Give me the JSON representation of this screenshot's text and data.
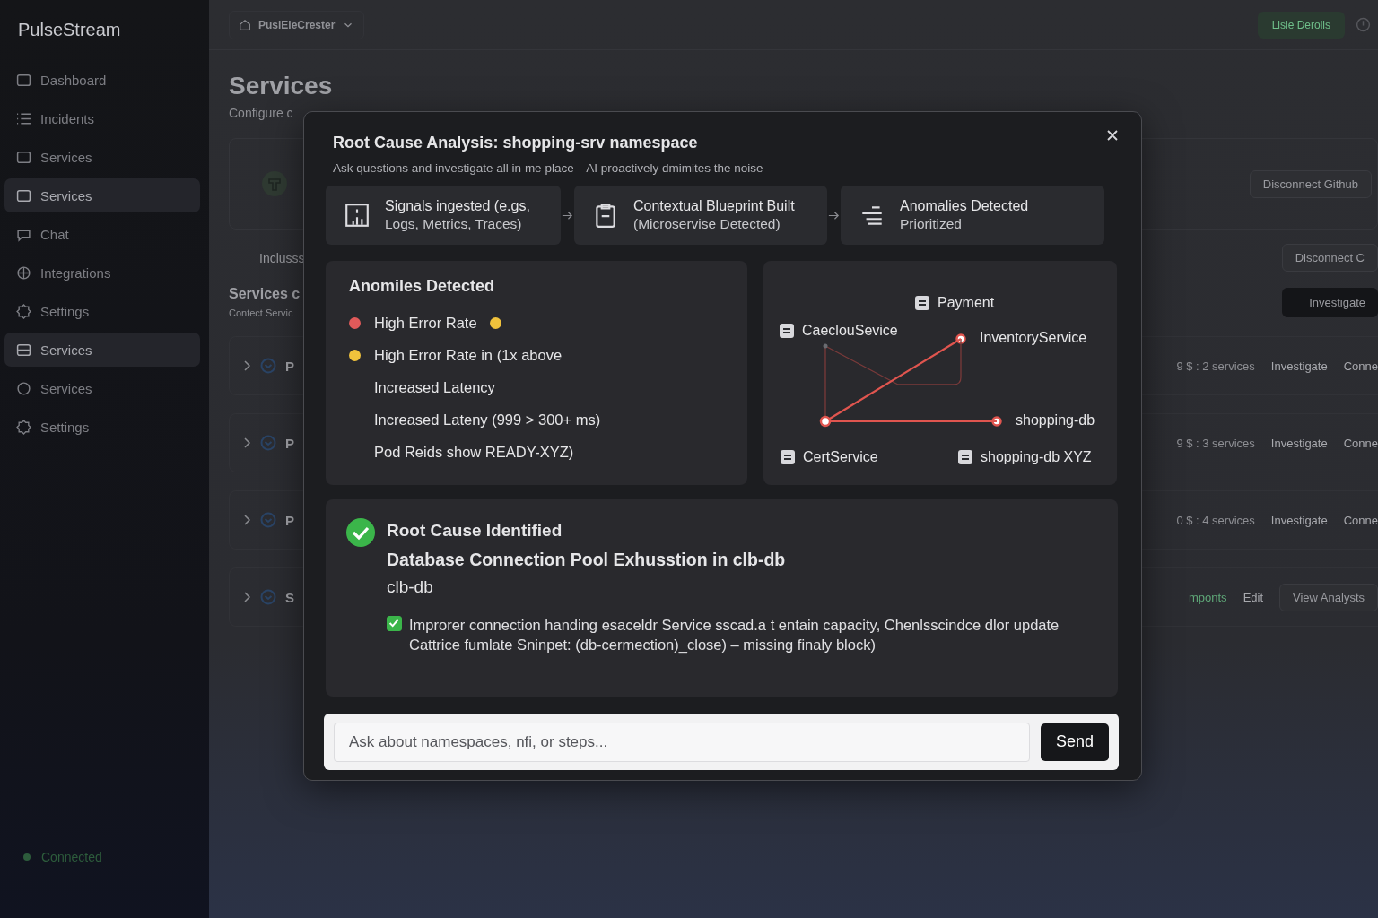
{
  "sidebar": {
    "brand": "PulseStream",
    "items": [
      {
        "label": "Dashboard",
        "selected": false
      },
      {
        "label": "Incidents",
        "selected": false
      },
      {
        "label": "Services",
        "selected": false
      },
      {
        "label": "Services",
        "selected": true
      },
      {
        "label": "Chat",
        "selected": false
      },
      {
        "label": "Integrations",
        "selected": false
      },
      {
        "label": "Settings",
        "selected": false
      },
      {
        "label": "Services",
        "selected": true
      },
      {
        "label": "Services",
        "selected": false
      },
      {
        "label": "Settings",
        "selected": false
      }
    ],
    "status": "Connected"
  },
  "header": {
    "workspace": "PusiEleCrester",
    "button": "Lisie Derolis"
  },
  "page": {
    "title": "Services",
    "subtitle": "Configure c",
    "card_button": "Disconnect Github",
    "section_label": "Inclusss",
    "section_button": "Disconnect C",
    "list_title": "Services c",
    "list_subtitle": "Contect Servic",
    "list_button": "Investigate",
    "rows": [
      {
        "kind": "investigate",
        "letter": "P",
        "meta": "9 $ : 2 services",
        "action": "Investigate",
        "extra": "Conne"
      },
      {
        "kind": "investigate",
        "letter": "P",
        "meta": "9 $ : 3 services",
        "action": "Investigate",
        "extra": "Conne"
      },
      {
        "kind": "investigate",
        "letter": "P",
        "meta": "0 $ : 4 services",
        "action": "Investigate",
        "extra": "Conne"
      },
      {
        "kind": "edit",
        "letter": "S",
        "meta": "mponts",
        "action": "Edit",
        "extra": "View Analysts"
      }
    ]
  },
  "modal": {
    "title": "Root Cause Analysis: shopping-srv namespace",
    "subtitle": "Ask questions and investigate all in me place—AI proactively dmimites the noise",
    "steps": [
      {
        "title": "Signals ingested (e.gs,",
        "detail": "Logs, Metrics, Traces)"
      },
      {
        "title": "Contextual Blueprint Built",
        "detail": "(Microservise Detected)"
      },
      {
        "title": "Anomalies Detected",
        "detail": "Prioritized"
      }
    ],
    "anomalies": {
      "title": "Anomiles Detected",
      "items": [
        {
          "text": "High Error Rate",
          "color": "#e05a5a",
          "end_dot": {
            "color": "#f0c23c"
          }
        },
        {
          "text": "High Error Rate in (1x above",
          "color": "#f0c23c"
        },
        {
          "text": "Increased Latency"
        },
        {
          "text": "Increased Lateny (999 > 300+ ms)"
        },
        {
          "text": "Pod Reids show READY-XYZ)"
        }
      ]
    },
    "diagram": {
      "nodes": [
        {
          "label": "Payment",
          "kind": "icon"
        },
        {
          "label": "CaeclouSevice",
          "kind": "icon"
        },
        {
          "label": "InventoryService",
          "kind": "dot"
        },
        {
          "label": "shopping-db",
          "kind": "dot"
        },
        {
          "label": "CertService",
          "kind": "icon"
        },
        {
          "label": "shopping-db XYZ",
          "kind": "icon"
        }
      ]
    },
    "root_cause": {
      "title": "Root Cause Identified",
      "headline": "Database Connection Pool Exhusstion in clb-db",
      "target": "clb-db",
      "finding": {
        "text": "Improrer connection handing esaceldr Service sscad.a t entain capacity, Chenlsscindce dlor update Cattrice fumlate Sninpet: (db-cermection)_close) – missing finaly block)",
        "checked": true
      }
    },
    "chat": {
      "placeholder": "Ask about namespaces, nfi, or steps...",
      "button": "Send"
    }
  }
}
